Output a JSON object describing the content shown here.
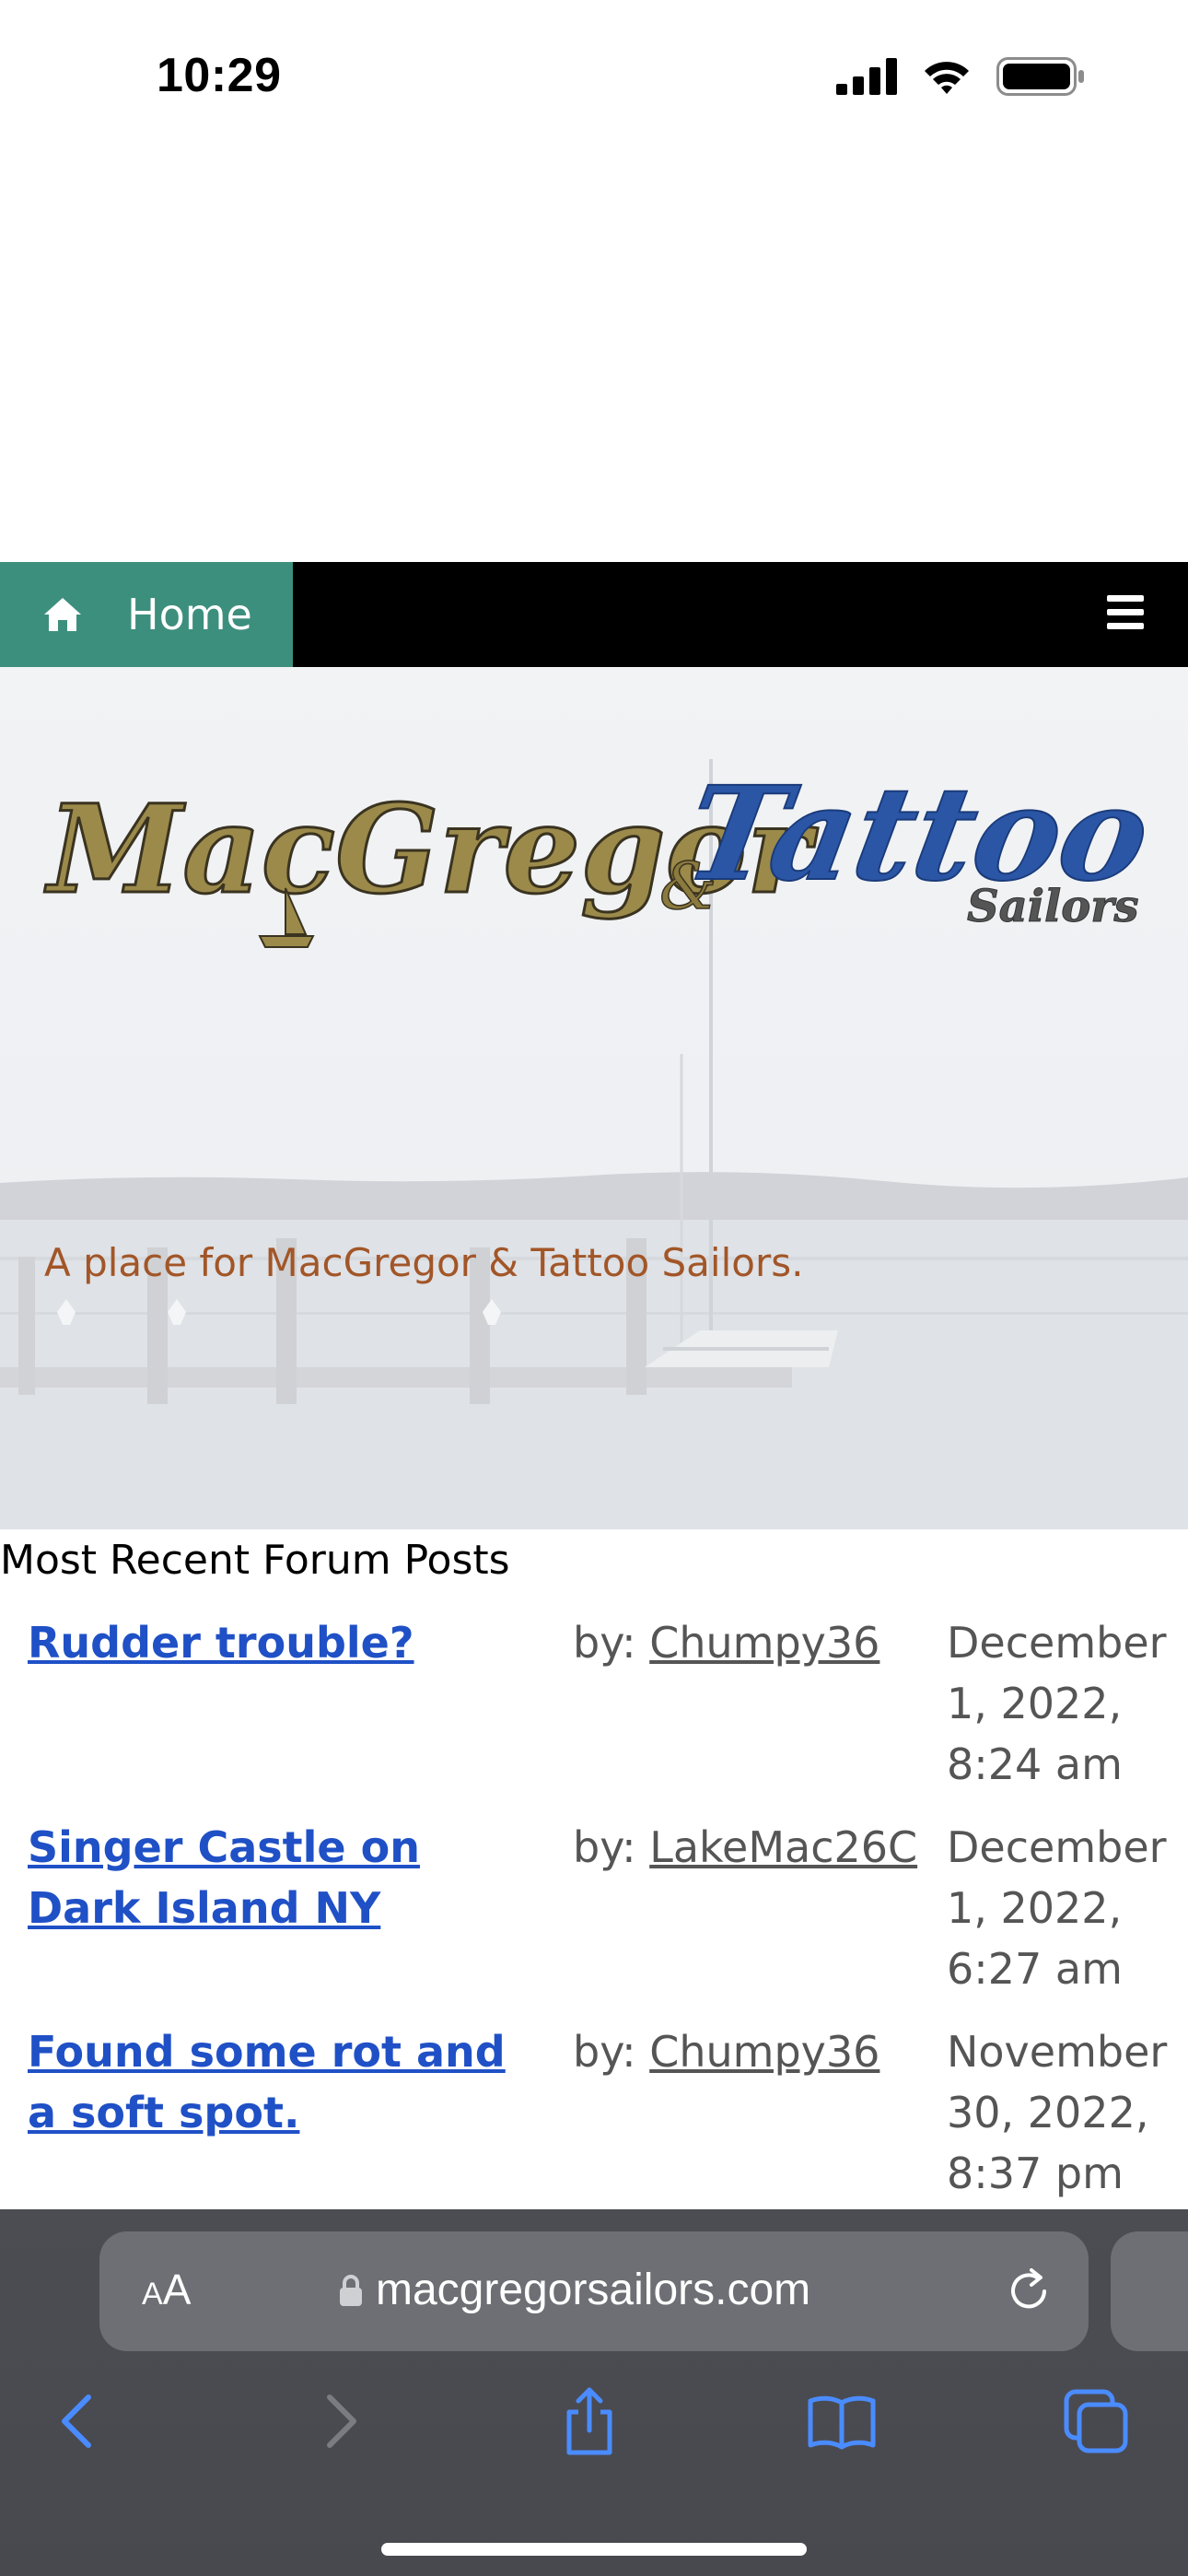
{
  "status_bar": {
    "time": "10:29",
    "icons": [
      "cellular-signal-icon",
      "wifi-icon",
      "battery-icon"
    ]
  },
  "nav": {
    "home_label": "Home",
    "home_icon": "home-icon",
    "menu_icon": "hamburger-menu-icon",
    "home_bg_color": "#3d8f7d",
    "bar_color": "#000000"
  },
  "banner": {
    "logo_text_1": "MacGregor",
    "logo_amp": "&",
    "logo_text_2": "Tattoo",
    "logo_text_3": "Sailors",
    "tagline": "A place for MacGregor & Tattoo Sailors.",
    "tagline_color": "#a25628"
  },
  "forum": {
    "heading": "Most Recent Forum Posts",
    "by_prefix": "by:",
    "posts": [
      {
        "title": "Rudder trouble?",
        "author": "Chumpy36",
        "date": "December 1, 2022, 8:24 am"
      },
      {
        "title": "Singer Castle on Dark Island NY",
        "author": "LakeMac26C",
        "date": "December 1, 2022, 6:27 am"
      },
      {
        "title": "Found some rot and a soft spot.",
        "author": "Chumpy36",
        "date": "November 30, 2022, 8:37 pm"
      }
    ]
  },
  "safari": {
    "aa_small": "A",
    "aa_big": "A",
    "url": "macgregorsailors.com",
    "icons": [
      "back-icon",
      "forward-icon",
      "share-icon",
      "bookmarks-icon",
      "tabs-icon",
      "lock-icon",
      "reload-icon"
    ]
  }
}
